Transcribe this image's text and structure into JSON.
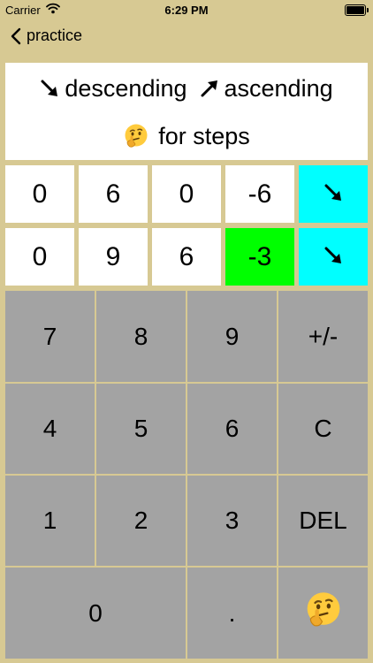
{
  "status_bar": {
    "carrier": "Carrier",
    "time": "6:29 PM"
  },
  "nav": {
    "back_label": "practice"
  },
  "instructions": {
    "descending_label": "descending",
    "ascending_label": "ascending",
    "steps_label": "for steps"
  },
  "rows": [
    {
      "digits": [
        "0",
        "6",
        "0"
      ],
      "result": "-6",
      "result_color": "#ffffff",
      "direction": "descending"
    },
    {
      "digits": [
        "0",
        "9",
        "6"
      ],
      "result": "-3",
      "result_color": "#00ff00",
      "direction": "descending"
    }
  ],
  "keypad": {
    "row1": [
      "7",
      "8",
      "9",
      "+/-"
    ],
    "row2": [
      "4",
      "5",
      "6",
      "C"
    ],
    "row3": [
      "1",
      "2",
      "3",
      "DEL"
    ],
    "row4": [
      "0",
      "."
    ]
  },
  "colors": {
    "background": "#d7c993",
    "key": "#a3a3a3",
    "direction_button": "#00ffff",
    "correct": "#00ff00"
  },
  "icons": {
    "descending": "arrow-down-right-icon",
    "ascending": "arrow-up-right-icon",
    "hint": "thinking-face-icon"
  }
}
